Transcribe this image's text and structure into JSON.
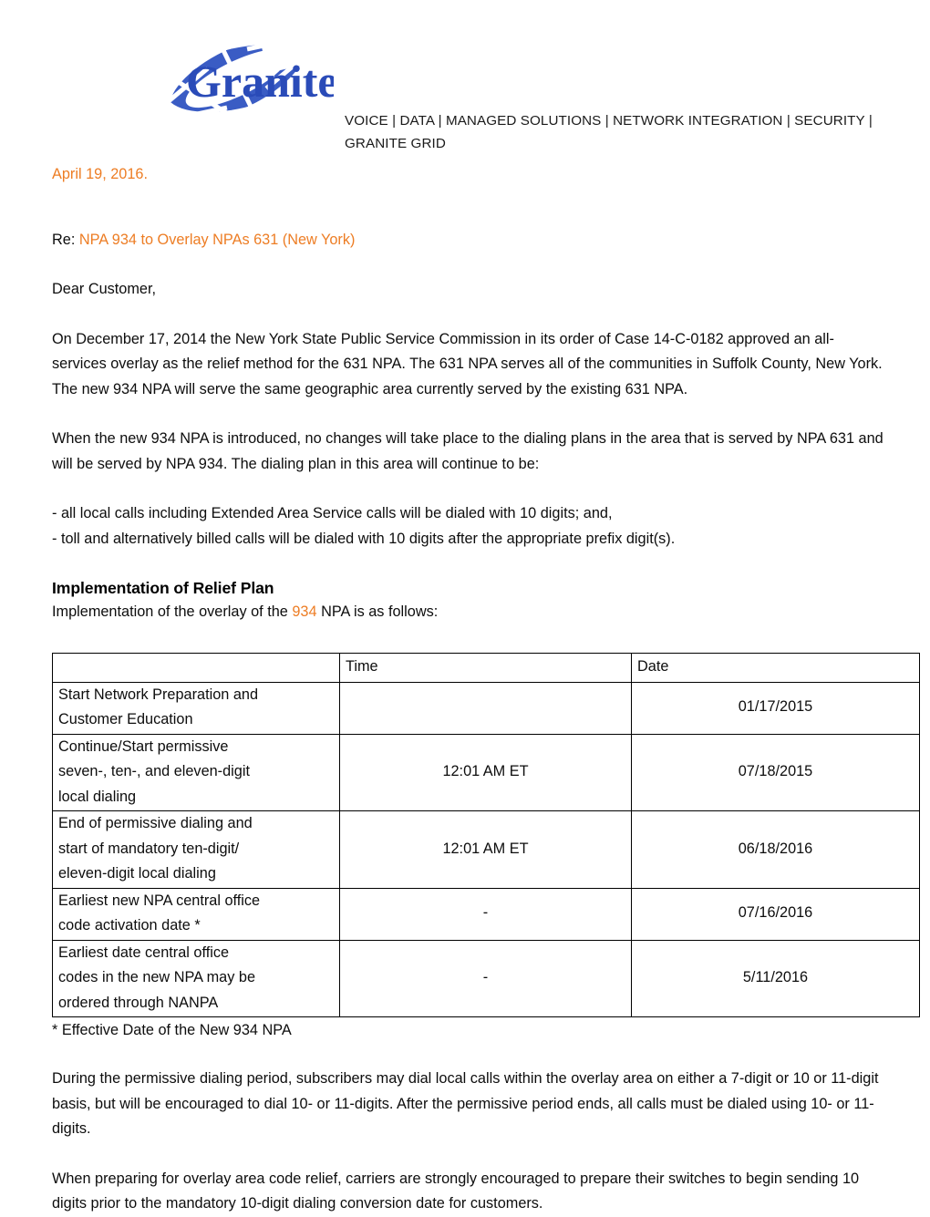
{
  "letterhead": {
    "logo_text": "Granite",
    "tagline": "VOICE | DATA | MANAGED SOLUTIONS | NETWORK INTEGRATION | SECURITY | GRANITE GRID",
    "brand_blue": "#3A5CC4",
    "accent_orange": "#ED7D24"
  },
  "letter": {
    "date": "April 19, 2016.",
    "re_label": "Re:",
    "re_subject": "NPA 934 to Overlay NPAs 631 (New York)",
    "salutation": "Dear Customer,",
    "paragraph_1": "On December 17, 2014 the New York State Public Service Commission in its order of Case 14-C-0182 approved an all-services overlay as the relief method for the 631 NPA. The 631 NPA serves all of the communities in Suffolk County, New York. The new 934 NPA will serve the same geographic area currently served by the existing 631 NPA.",
    "paragraph_2": "When the new 934 NPA is introduced, no changes will take place to the dialing plans in the area that is served by NPA 631 and will be served by NPA 934. The dialing plan in this area will continue to be:",
    "bullet_1": "- all local calls including Extended Area Service calls will be dialed with 10 digits; and,",
    "bullet_2": "- toll and alternatively billed calls will be dialed with 10 digits after the appropriate prefix digit(s).",
    "section_title": "Implementation of Relief Plan",
    "section_intro_before": "Implementation of the overlay of the ",
    "section_intro_highlight": "934",
    "section_intro_after": " NPA is as follows:",
    "footnote": "* Effective Date of the New 934 NPA",
    "paragraph_3": "During the permissive dialing period, subscribers may dial local calls within the overlay area on either a 7-digit or 10 or 11-digit basis, but will be encouraged to dial 10- or 11-digits. After the permissive period ends, all calls must be dialed using 10- or 11-digits.",
    "paragraph_4": "When preparing for overlay area code relief, carriers are strongly encouraged to prepare their switches to begin sending 10 digits prior to the mandatory 10-digit dialing conversion date for customers."
  },
  "schedule_table": {
    "headers": [
      "",
      "Time",
      "Date"
    ],
    "rows": [
      {
        "label_lines": [
          "Start Network Preparation and",
          "Customer Education"
        ],
        "time": "",
        "date": "01/17/2015"
      },
      {
        "label_lines": [
          "Continue/Start permissive",
          "seven-, ten-, and eleven-digit",
          "local dialing"
        ],
        "time": "12:01 AM ET",
        "date": "07/18/2015"
      },
      {
        "label_lines": [
          "End of permissive dialing and",
          "start of mandatory ten-digit/",
          "eleven-digit local dialing"
        ],
        "time": "12:01 AM ET",
        "date": "06/18/2016"
      },
      {
        "label_lines": [
          "Earliest new NPA central office",
          "code activation date *"
        ],
        "time": "-",
        "date": "07/16/2016"
      },
      {
        "label_lines": [
          "Earliest date central office",
          "codes in the new NPA may be",
          "ordered through NANPA"
        ],
        "time": "-",
        "date": "5/11/2016"
      }
    ]
  }
}
